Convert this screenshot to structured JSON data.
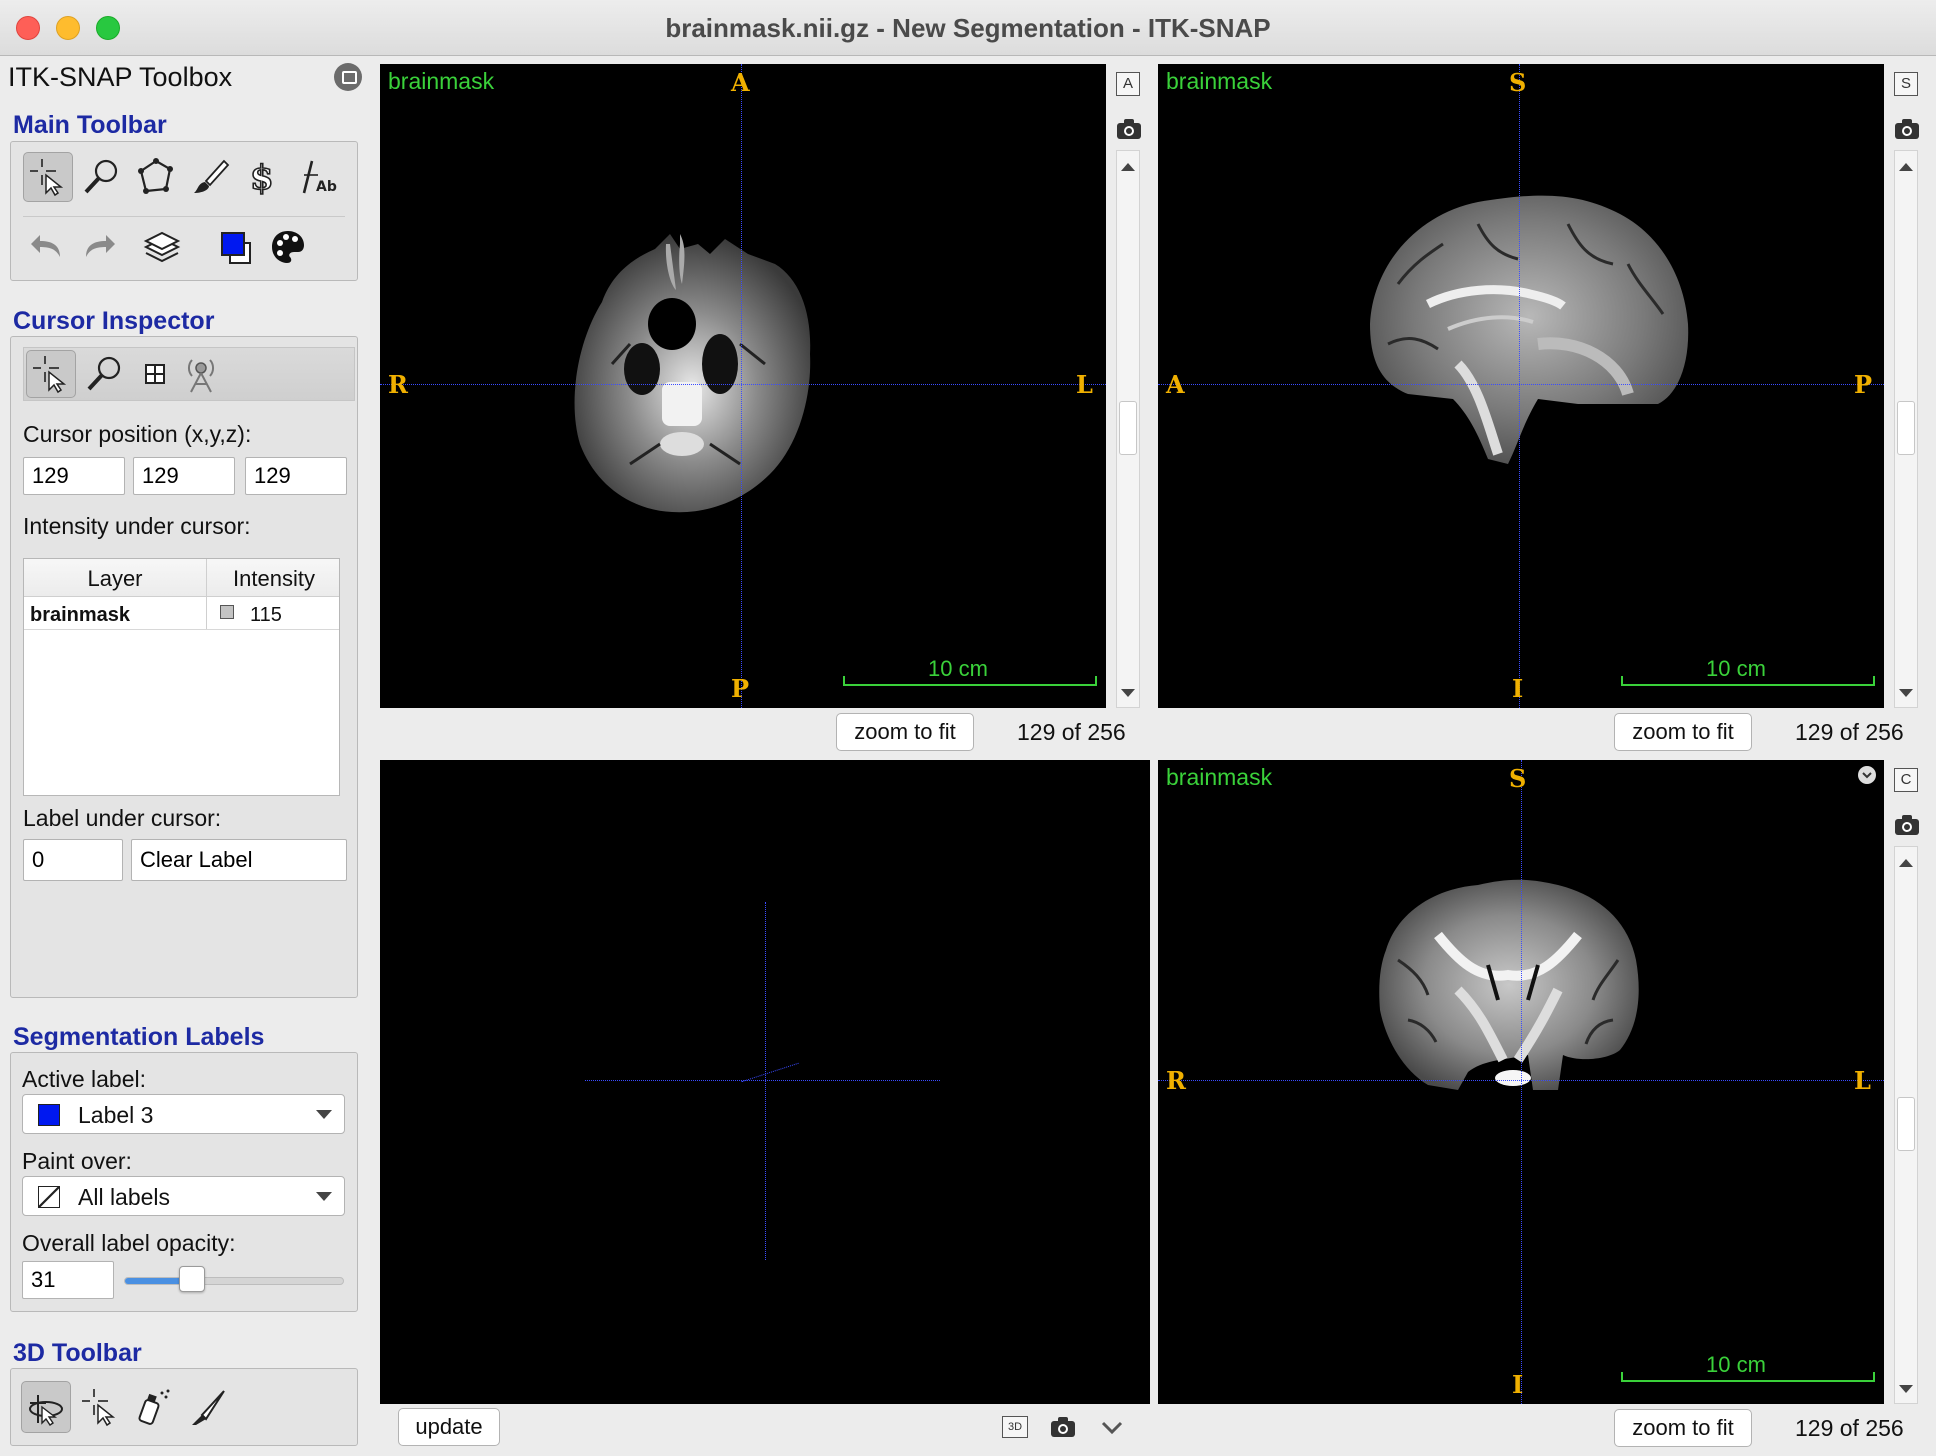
{
  "window": {
    "title": "brainmask.nii.gz - New Segmentation - ITK-SNAP"
  },
  "toolbox": {
    "title": "ITK-SNAP Toolbox",
    "main_toolbar": {
      "title": "Main Toolbar",
      "tools": [
        "crosshair-tool",
        "zoom-tool",
        "polygon-tool",
        "paintbrush-tool",
        "snake-tool",
        "annotation-tool"
      ],
      "actions": [
        "undo",
        "redo",
        "layers",
        "label-color",
        "color-palette"
      ]
    },
    "cursor_inspector": {
      "title": "Cursor Inspector",
      "position_label": "Cursor position (x,y,z):",
      "x": "129",
      "y": "129",
      "z": "129",
      "intensity_label": "Intensity under cursor:",
      "table": {
        "headers": [
          "Layer",
          "Intensity"
        ],
        "rows": [
          {
            "layer": "brainmask",
            "intensity": "115"
          }
        ]
      },
      "label_under_cursor": "Label under cursor:",
      "label_value": "0",
      "label_name": "Clear Label"
    },
    "segmentation_labels": {
      "title": "Segmentation Labels",
      "active_label_caption": "Active label:",
      "active_label": "Label 3",
      "active_label_color": "#0018f0",
      "paint_over_caption": "Paint over:",
      "paint_over": "All labels",
      "opacity_caption": "Overall label opacity:",
      "opacity": "31",
      "opacity_fraction": 0.31
    },
    "toolbar_3d": {
      "title": "3D Toolbar"
    }
  },
  "views": {
    "axial": {
      "layer": "brainmask",
      "top": "A",
      "bottom": "P",
      "left": "R",
      "right": "L",
      "scale": "10 cm",
      "badge": "A",
      "zoom_button": "zoom to fit",
      "slice": "129 of 256"
    },
    "sagittal": {
      "layer": "brainmask",
      "top": "S",
      "bottom": "I",
      "left": "A",
      "right": "P",
      "scale": "10 cm",
      "badge": "S",
      "zoom_button": "zoom to fit",
      "slice": "129 of 256"
    },
    "view3d": {
      "update_button": "update",
      "badge": "3D"
    },
    "coronal": {
      "layer": "brainmask",
      "top": "S",
      "bottom": "I",
      "left": "R",
      "right": "L",
      "scale": "10 cm",
      "badge": "C",
      "zoom_button": "zoom to fit",
      "slice": "129 of 256"
    }
  },
  "colors": {
    "section_title": "#1d2aa3",
    "overlay_text": "#3ad13a",
    "orientation": "#f0b000",
    "crosshair": "#3a4bff"
  }
}
